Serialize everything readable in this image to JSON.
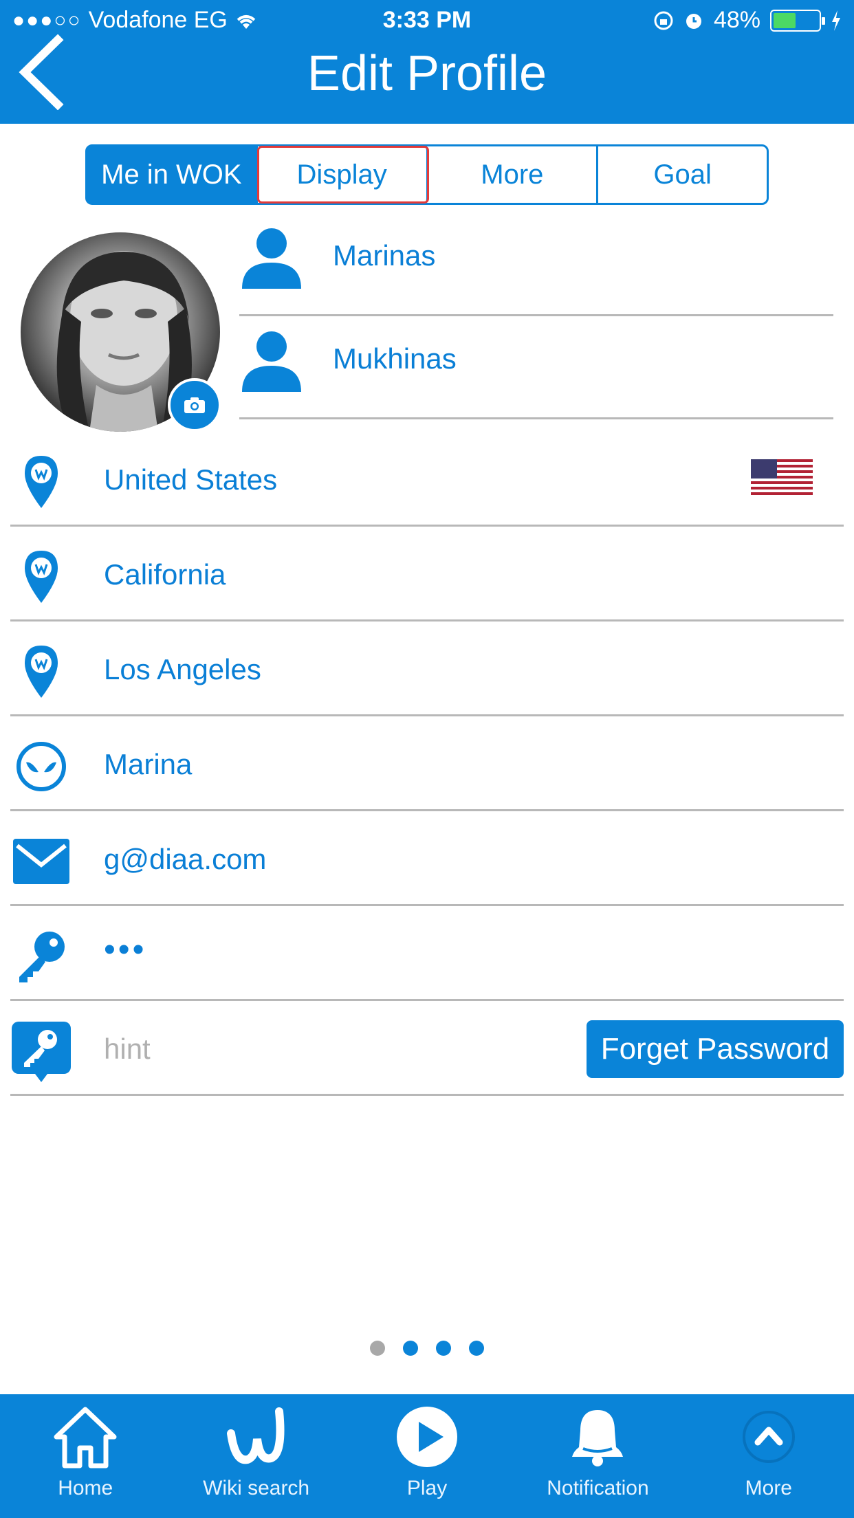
{
  "status_bar": {
    "carrier": "Vodafone EG",
    "time": "3:33 PM",
    "battery": "48%"
  },
  "header": {
    "title": "Edit Profile"
  },
  "tabs": [
    {
      "label": "Me in WOK"
    },
    {
      "label": "Display"
    },
    {
      "label": "More"
    },
    {
      "label": "Goal"
    }
  ],
  "profile": {
    "first_name": "Marinas",
    "last_name": "Mukhinas"
  },
  "fields": {
    "country": "United States",
    "state": "California",
    "city": "Los Angeles",
    "nickname": "Marina",
    "email": "g@diaa.com",
    "password": "•••",
    "hint_placeholder": "hint",
    "forget_password_label": "Forget Password"
  },
  "tabbar": [
    {
      "label": "Home",
      "icon": "home-icon"
    },
    {
      "label": "Wiki search",
      "icon": "wiki-icon"
    },
    {
      "label": "Play",
      "icon": "play-icon"
    },
    {
      "label": "Notification",
      "icon": "bell-icon"
    },
    {
      "label": "More",
      "icon": "chevron-up-icon"
    }
  ],
  "colors": {
    "accent": "#0a84d8",
    "divider": "#b8b8b8",
    "highlight": "#e23a3a"
  }
}
